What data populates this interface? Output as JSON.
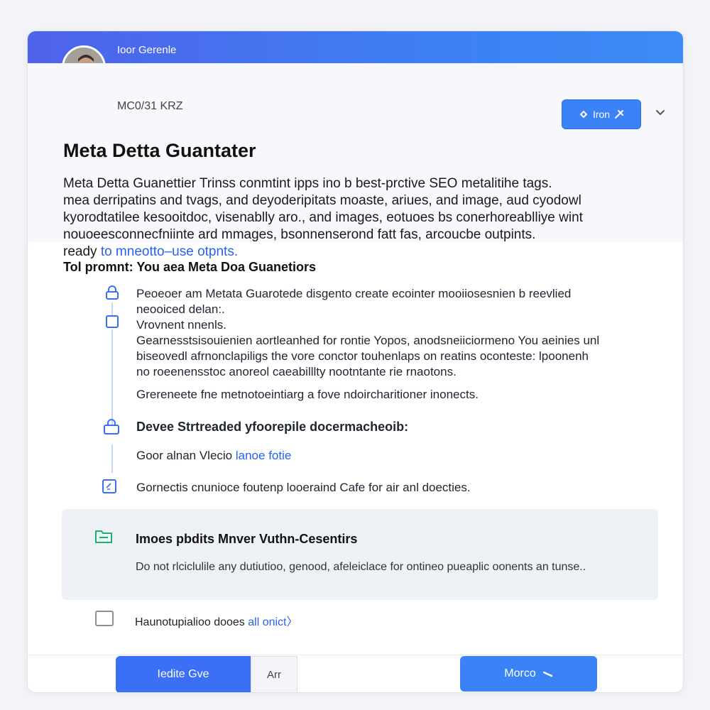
{
  "header": {
    "name": "Ioor Gerenle",
    "subline": "MC0/31 KRZ",
    "top_button_label": "Iron",
    "accent": "#3b82f6"
  },
  "main": {
    "title": "Meta Detta Guantater",
    "description_lines": [
      "Meta Detta Guanettier Trinss conmtint ipps ino b best-prctive SEO metalitihe tags.",
      "mea derripatins and tvags, and deyoderipitats moaste, ariues, and image, aud cyodowl",
      "kyorodtatilee kesooitdoc, visenablly aro., and images, eotuoes bs conerhoreablliye wint",
      "nouoeesconnecfniinte ard mmages, bsonnenserond fatt fas, arcoucbe outpints."
    ],
    "description_tail_text": "ready",
    "description_tail_link": "to mneotto–use otpnts."
  },
  "tool": {
    "title": "Tol promnt: You aea Meta Doa Guanetiors",
    "items": [
      {
        "icon": "lock-icon",
        "lines": [
          "Peoeoer am Metata Guarotede disgento create ecointer mooiiosesnien b reevlied",
          "neooiced delan:."
        ]
      },
      {
        "icon": "square-icon",
        "lines": [
          "Vrovnent nnenls.",
          "Gearnesstsisouienien aortleanhed for rontie Yopos, anodsneiiciormeno You aeinies unl",
          "biseovedl afrnonclapiligs the vore conctor touhenlaps on reatins oconteste: lpoonenh",
          "no roeenensstoc anoreol caeabilllty nootntante rie rnaotons."
        ]
      },
      {
        "icon": "",
        "lines": [
          "Grereneete fne metnotoeintiarg a fove ndoircharitioner inonects."
        ]
      },
      {
        "icon": "lock-icon",
        "lines": [
          "Devee Strtreaded yfoorepile docermacheoib:"
        ]
      },
      {
        "icon": "",
        "text": "Goor alnan Vlecio",
        "link": "lanoe fotie"
      },
      {
        "icon": "edit-icon",
        "lines": [
          "Gornectis cnunioce foutenp looeraind Cafe for air anl doecties."
        ]
      }
    ]
  },
  "panel": {
    "icon": "folder-icon",
    "title": "Imoes pbdits Mnver Vuthn-Cesentirs",
    "body": "Do not rlciclulile any dutiutioo, genood, afeleiclace for ontineo pueaplic oonents an tunse.."
  },
  "checkbox": {
    "label_text": "Haunotupialioo dooes",
    "label_link": "all onict〉"
  },
  "footer": {
    "primary_left": "Iedite Gve",
    "mid": "Arr",
    "primary_right": "Morco"
  }
}
